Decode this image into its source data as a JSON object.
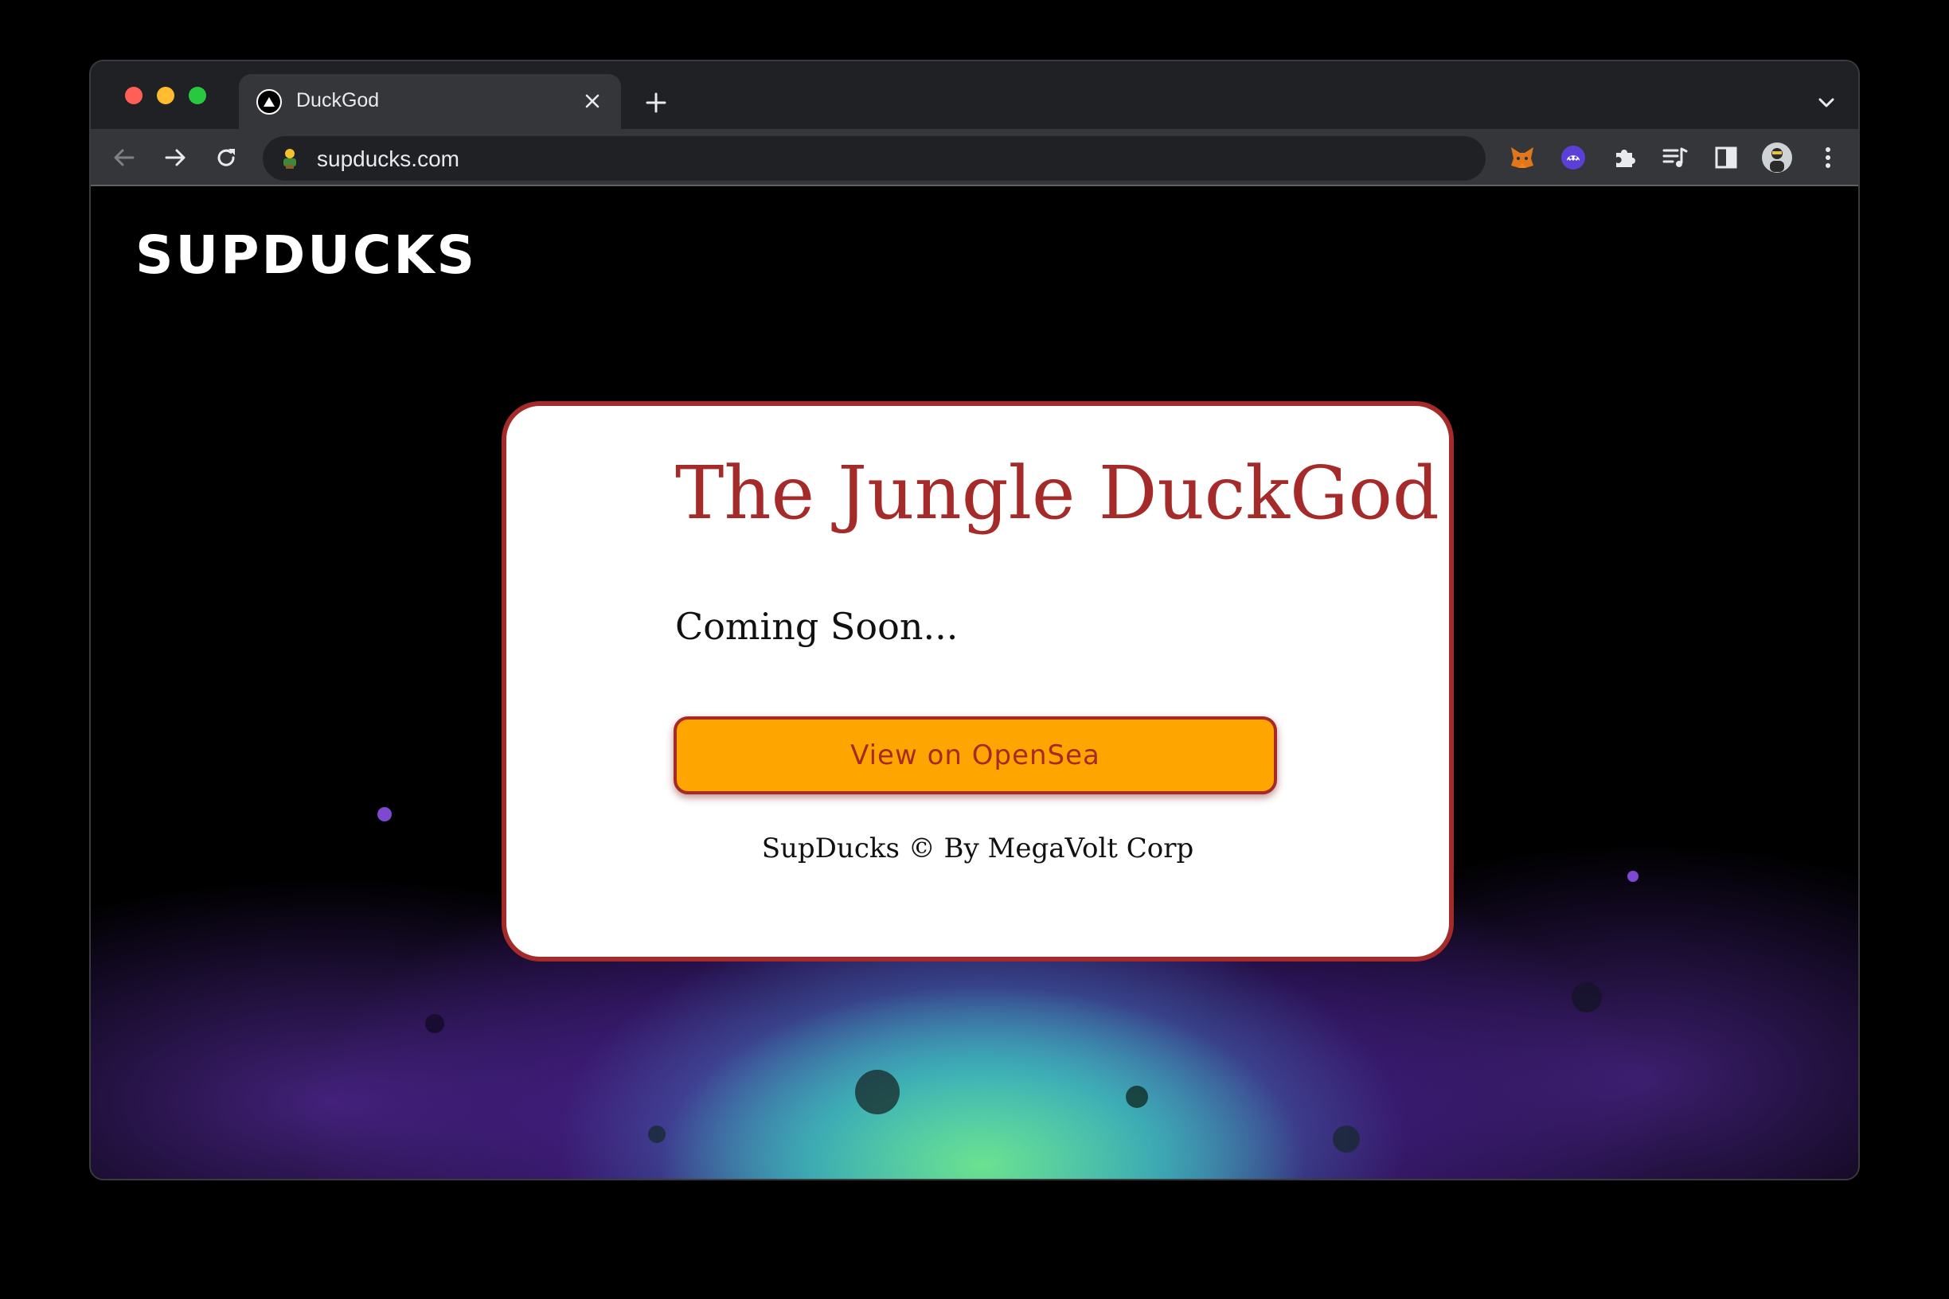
{
  "browser": {
    "tab": {
      "title": "DuckGod"
    },
    "address_bar": {
      "url": "supducks.com"
    },
    "colors": {
      "chrome_dark": "#202124",
      "chrome_toolbar": "#35363a",
      "text": "#e8eaed"
    },
    "extensions": [
      "metamask-fox-icon",
      "ghost-wallet-icon",
      "puzzle-extensions-icon",
      "reading-list-icon",
      "side-panel-icon",
      "profile-avatar",
      "kebab-menu-icon"
    ]
  },
  "page": {
    "logo": "SUPDUCKS",
    "card": {
      "title": "The Jungle DuckGod",
      "subtitle": "Coming Soon...",
      "button_label": "View on OpenSea",
      "footer": "SupDucks © By MegaVolt Corp"
    },
    "colors": {
      "accent": "#a52a2a",
      "button_bg": "#ffa500",
      "card_bg": "#ffffff",
      "page_bg": "#000000"
    }
  }
}
